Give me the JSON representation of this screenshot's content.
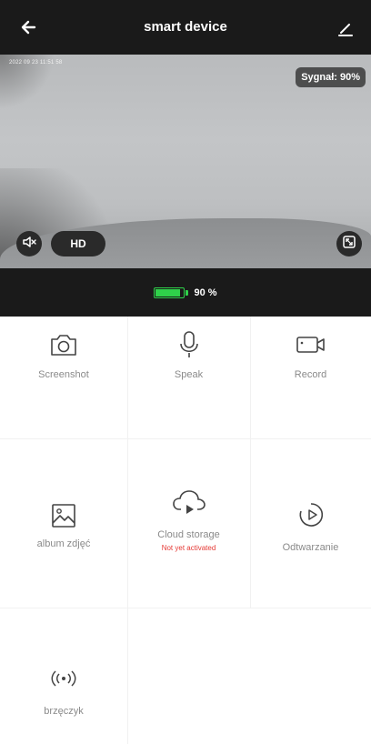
{
  "header": {
    "title": "smart device"
  },
  "video": {
    "timestamp": "2022 09 23  11:51 58",
    "signal_label": "Sygnał: 90%",
    "quality_label": "HD"
  },
  "battery": {
    "level_percent": 90,
    "label": "90 %",
    "color": "#2fd24a"
  },
  "actions": {
    "screenshot": "Screenshot",
    "speak": "Speak",
    "record": "Record",
    "album": "album zdjęć",
    "cloud": "Cloud storage",
    "cloud_status": "Not yet activated",
    "playback": "Odtwarzanie",
    "buzzer": "brzęczyk"
  },
  "colors": {
    "header_bg": "#1a1a1a",
    "label_gray": "#8a8a8a",
    "warning_red": "#e53935"
  }
}
